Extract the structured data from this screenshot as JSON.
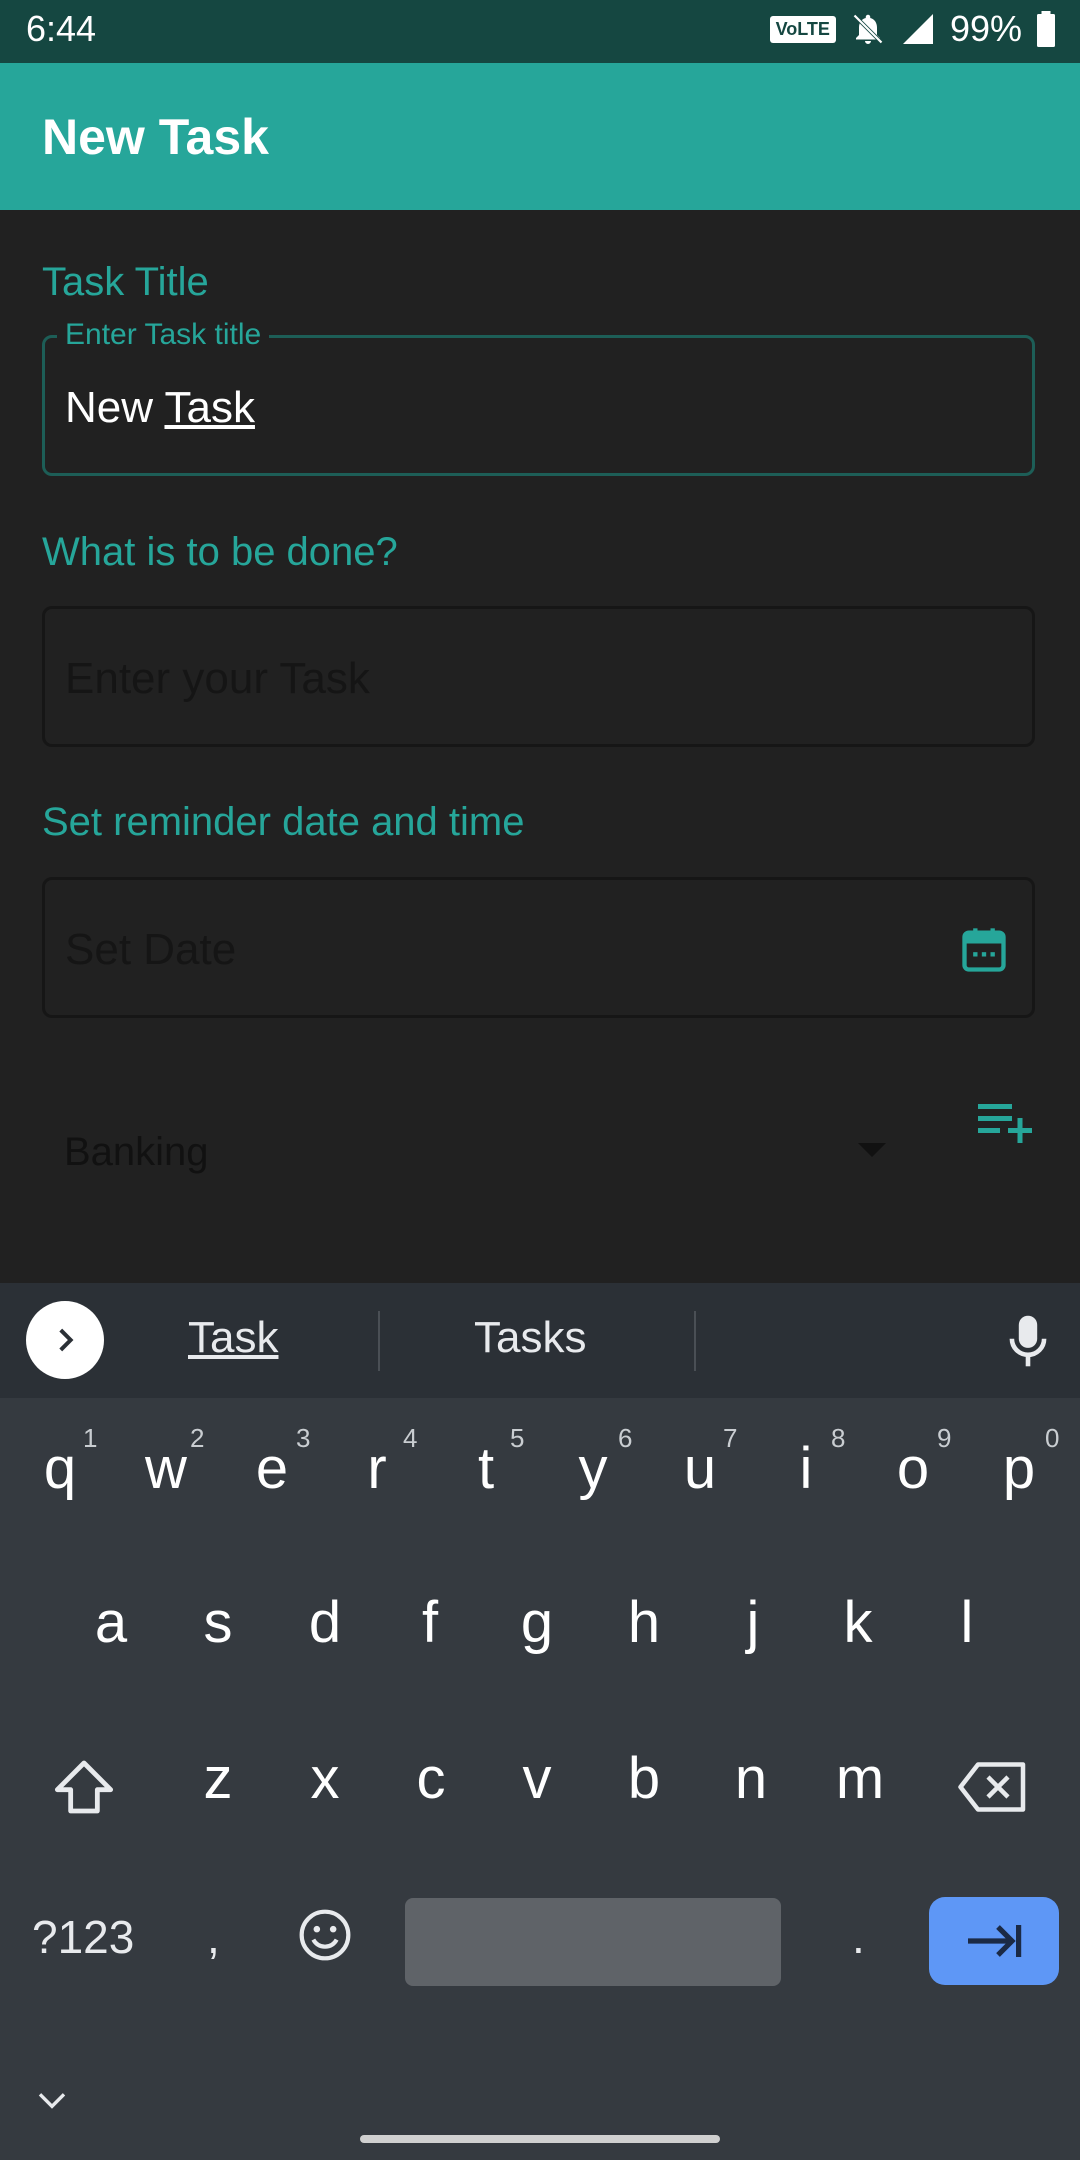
{
  "status": {
    "time": "6:44",
    "volte": "VoLTE",
    "battery": "99%"
  },
  "appbar": {
    "title": "New Task"
  },
  "form": {
    "title_label": "Task Title",
    "title_float": "Enter Task title",
    "title_value_word1": "New",
    "title_value_word2": "Task",
    "task_label": "What is to be done?",
    "task_placeholder": "Enter your Task",
    "reminder_label": "Set reminder date and time",
    "date_placeholder": "Set Date",
    "category": "Banking"
  },
  "keyboard": {
    "suggestions": [
      "Task",
      "Tasks"
    ],
    "row1": [
      "q",
      "w",
      "e",
      "r",
      "t",
      "y",
      "u",
      "i",
      "o",
      "p"
    ],
    "row1_nums": [
      "1",
      "2",
      "3",
      "4",
      "5",
      "6",
      "7",
      "8",
      "9",
      "0"
    ],
    "row2": [
      "a",
      "s",
      "d",
      "f",
      "g",
      "h",
      "j",
      "k",
      "l"
    ],
    "row3": [
      "z",
      "x",
      "c",
      "v",
      "b",
      "n",
      "m"
    ],
    "symbols_key": "?123",
    "comma": ",",
    "period": "."
  },
  "colors": {
    "accent": "#26a69a",
    "statusbar": "#154741",
    "enter": "#5e97f6"
  }
}
